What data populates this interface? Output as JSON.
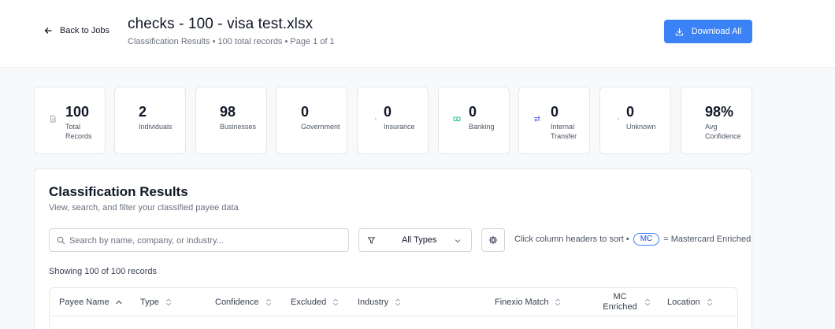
{
  "header": {
    "back_label": "Back to Jobs",
    "title": "checks - 100 - visa test.xlsx",
    "subtitle": "Classification Results • 100 total records • Page 1 of 1",
    "download_label": "Download All"
  },
  "stats": [
    {
      "value": "100",
      "label": "Total Records",
      "icon": "document-icon"
    },
    {
      "value": "2",
      "label": "Individuals",
      "icon": ""
    },
    {
      "value": "98",
      "label": "Businesses",
      "icon": ""
    },
    {
      "value": "0",
      "label": "Government",
      "icon": ""
    },
    {
      "value": "0",
      "label": "Insurance",
      "icon": "dot-icon"
    },
    {
      "value": "0",
      "label": "Banking",
      "icon": "banknote-icon"
    },
    {
      "value": "0",
      "label": "Internal Transfer",
      "icon": "transfer-arrows-icon"
    },
    {
      "value": "0",
      "label": "Unknown",
      "icon": "dot-icon"
    },
    {
      "value": "98%",
      "label": "Avg Confidence",
      "icon": ""
    }
  ],
  "results": {
    "title": "Classification Results",
    "subtitle": "View, search, and filter your classified payee data",
    "search_placeholder": "Search by name, company, or industry...",
    "type_filter": "All Types",
    "hint_prefix": "Click column headers to sort •",
    "mc_badge": "MC",
    "hint_suffix": "= Mastercard Enriched",
    "showing": "Showing 100 of 100 records",
    "columns": [
      "Payee Name",
      "Type",
      "Confidence",
      "Excluded",
      "Industry",
      "Finexio Match",
      "MC Enriched",
      "Location"
    ]
  },
  "colors": {
    "accent": "#3b82f6",
    "banking_icon": "#10b981",
    "transfer_icon": "#6366f1"
  }
}
